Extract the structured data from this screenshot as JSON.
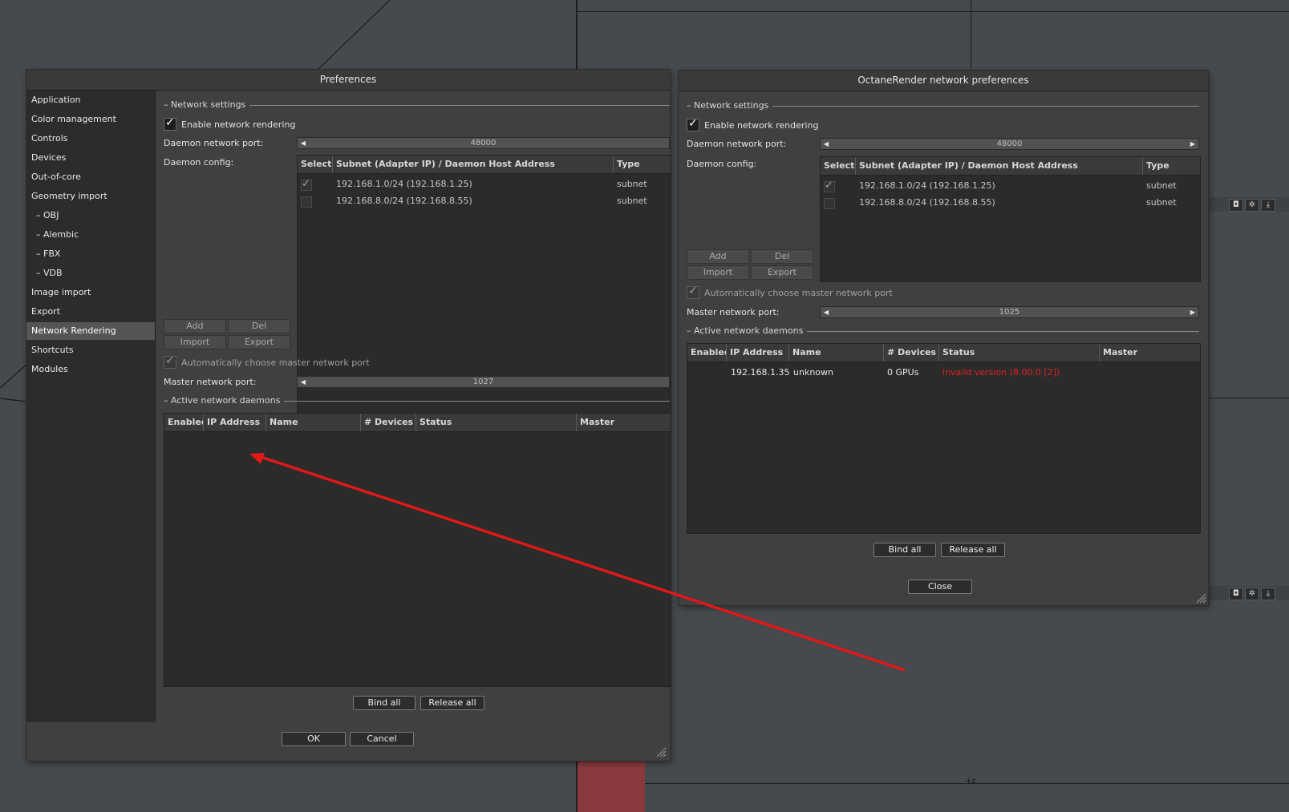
{
  "background": {
    "icons": [
      "camera-icon",
      "gear-icon",
      "download-icon"
    ],
    "axis_label": "+z",
    "colors": {
      "viewport": "#464a4e",
      "red_patch": "#8a3a3e"
    }
  },
  "preferences": {
    "title": "Preferences",
    "sidebar": [
      {
        "label": "Application"
      },
      {
        "label": "Color management"
      },
      {
        "label": "Controls"
      },
      {
        "label": "Devices"
      },
      {
        "label": "Out-of-core"
      },
      {
        "label": "Geometry import"
      },
      {
        "label": "–  OBJ"
      },
      {
        "label": "–  Alembic"
      },
      {
        "label": "–  FBX"
      },
      {
        "label": "–  VDB"
      },
      {
        "label": "Image import"
      },
      {
        "label": "Export"
      },
      {
        "label": "Network Rendering"
      },
      {
        "label": "Shortcuts"
      },
      {
        "label": "Modules"
      }
    ],
    "active_sidebar_item": "Network Rendering",
    "network_settings": "– Network settings",
    "enable_network_rendering": "Enable network rendering",
    "daemon_network_port_label": "Daemon network port:",
    "daemon_network_port": "48000",
    "daemon_config_label": "Daemon config:",
    "config_table": {
      "headers": [
        "Select",
        "Subnet (Adapter IP) / Daemon Host Address",
        "Type"
      ],
      "rows": [
        {
          "selected": true,
          "subnet": "192.168.1.0/24 (192.168.1.25)",
          "type": "subnet"
        },
        {
          "selected": false,
          "subnet": "192.168.8.0/24 (192.168.8.55)",
          "type": "subnet"
        }
      ]
    },
    "add": "Add",
    "del": "Del",
    "import": "Import",
    "export": "Export",
    "auto_master_port": "Automatically choose master network port",
    "master_network_port_label": "Master network port:",
    "master_network_port": "1027",
    "active_daemons_section": "– Active network daemons",
    "daemon_table_headers": [
      "Enabled",
      "IP Address",
      "Name",
      "# Devices",
      "Status",
      "Master"
    ],
    "bind_all": "Bind all",
    "release_all": "Release all",
    "ok": "OK",
    "cancel": "Cancel"
  },
  "octane": {
    "title": "OctaneRender network preferences",
    "network_settings": "– Network settings",
    "enable_network_rendering": "Enable network rendering",
    "daemon_network_port_label": "Daemon network port:",
    "daemon_network_port": "48000",
    "daemon_config_label": "Daemon config:",
    "config_table": {
      "headers": [
        "Select",
        "Subnet (Adapter IP) / Daemon Host Address",
        "Type"
      ],
      "rows": [
        {
          "selected": true,
          "subnet": "192.168.1.0/24 (192.168.1.25)",
          "type": "subnet"
        },
        {
          "selected": false,
          "subnet": "192.168.8.0/24 (192.168.8.55)",
          "type": "subnet"
        }
      ]
    },
    "add": "Add",
    "del": "Del",
    "import": "Import",
    "export": "Export",
    "auto_master_port": "Automatically choose master network port",
    "master_network_port_label": "Master network port:",
    "master_network_port": "1025",
    "active_daemons_section": "– Active network daemons",
    "daemon_table_headers": [
      "Enabled",
      "IP Address",
      "Name",
      "# Devices",
      "Status",
      "Master"
    ],
    "daemons": [
      {
        "ip": "192.168.1.35",
        "name": "unknown",
        "devices": "0 GPUs",
        "status": "invalid version (8.00.0 [2])"
      }
    ],
    "bind_all": "Bind all",
    "release_all": "Release all",
    "close": "Close",
    "status_error_color": "#e02020"
  },
  "annotation": {
    "arrow_color": "#e01818"
  }
}
